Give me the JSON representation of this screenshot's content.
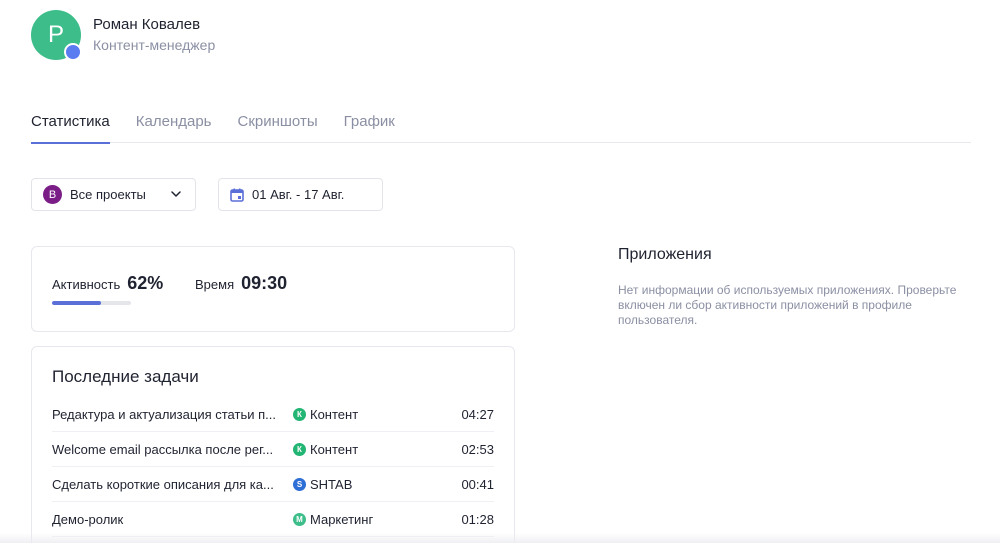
{
  "profile": {
    "initial": "Р",
    "name": "Роман Ковалев",
    "role": "Контент-менеджер",
    "avatar_color": "#3dbd8a",
    "status_color": "#5b7cf0"
  },
  "tabs": [
    {
      "label": "Статистика",
      "active": true
    },
    {
      "label": "Календарь",
      "active": false
    },
    {
      "label": "Скриншоты",
      "active": false
    },
    {
      "label": "График",
      "active": false
    }
  ],
  "filters": {
    "project": {
      "badge": "В",
      "badge_color": "#7a1d86",
      "label": "Все проекты",
      "icon": "chevron-down-icon"
    },
    "date_range": {
      "icon": "calendar-icon",
      "label": "01 Авг. - 17 Авг."
    }
  },
  "activity": {
    "activity_label": "Активность",
    "activity_value": "62%",
    "activity_fraction": 0.62,
    "time_label": "Время",
    "time_value": "09:30"
  },
  "tasks": {
    "title": "Последние задачи",
    "rows": [
      {
        "name": "Редактура и актуализация статьи п...",
        "project_badge": "К",
        "project_color": "#22b573",
        "project": "Контент",
        "time": "04:27"
      },
      {
        "name": "Welcome email рассылка после рег...",
        "project_badge": "К",
        "project_color": "#22b573",
        "project": "Контент",
        "time": "02:53"
      },
      {
        "name": "Сделать короткие описания для ка...",
        "project_badge": "S",
        "project_color": "#2d6fd6",
        "project": "SHTAB",
        "time": "00:41"
      },
      {
        "name": "Демо-ролик",
        "project_badge": "М",
        "project_color": "#3dbd8a",
        "project": "Маркетинг",
        "time": "01:28"
      }
    ]
  },
  "apps": {
    "title": "Приложения",
    "message": "Нет информации об используемых приложениях. Проверьте включен ли сбор активности приложений в профиле пользователя."
  }
}
